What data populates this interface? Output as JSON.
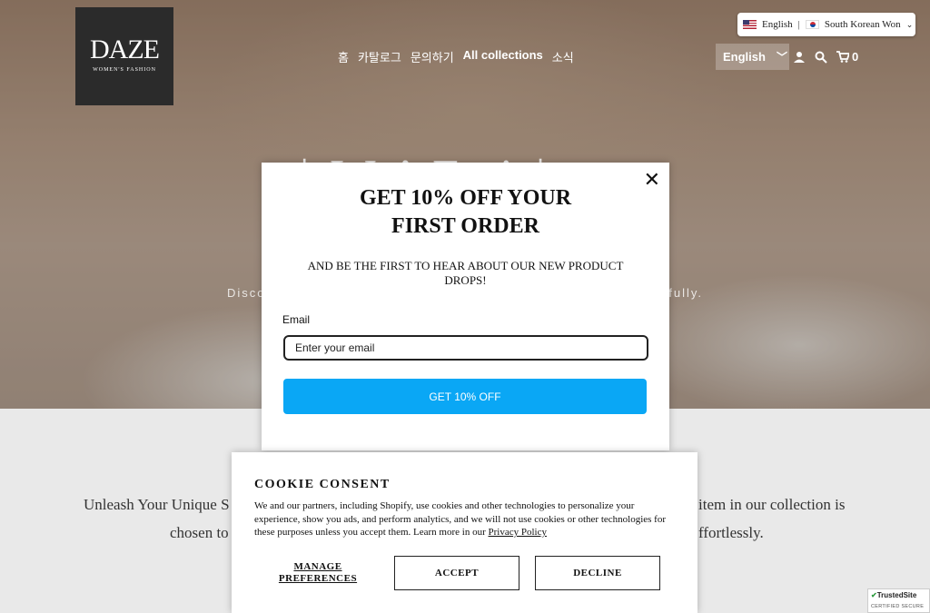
{
  "header": {
    "logo_title": "DAZE",
    "logo_subtitle": "WOMEN'S FASHION",
    "nav": [
      "홈",
      "카탈로그",
      "문의하기",
      "All collections",
      "소식"
    ],
    "language_pill": {
      "language": "English",
      "currency": "South Korean Won"
    },
    "language_select": "English",
    "cart_count": "0"
  },
  "hero": {
    "title_partial": "| W     ’ F  ti  |",
    "subtitle_left": "Disco",
    "subtitle_right": "fully."
  },
  "lower": {
    "line1_left": "Unleash Your Unique S",
    "line1_right": "item in our collection is",
    "line2_left": "chosen to",
    "line2_right": "ffortlessly."
  },
  "popup": {
    "close_symbol": "✕",
    "headline": "GET 10% OFF YOUR FIRST ORDER",
    "subtext": "AND BE THE FIRST TO HEAR ABOUT OUR NEW PRODUCT DROPS!",
    "email_label": "Email",
    "email_placeholder": "Enter your email",
    "cta_label": "GET 10% OFF",
    "cta_color": "#0aa7f5"
  },
  "cookie": {
    "title": "COOKIE CONSENT",
    "body": "We and our partners, including Shopify, use cookies and other technologies to personalize your experience, show you ads, and perform analytics, and we will not use cookies or other technologies for these purposes unless you accept them. Learn more in our ",
    "privacy_link": "Privacy Policy",
    "manage_label": "MANAGE PREFERENCES",
    "accept_label": "ACCEPT",
    "decline_label": "DECLINE"
  },
  "trusted_badge": {
    "name": "TrustedSite",
    "caption": "CERTIFIED SECURE"
  }
}
